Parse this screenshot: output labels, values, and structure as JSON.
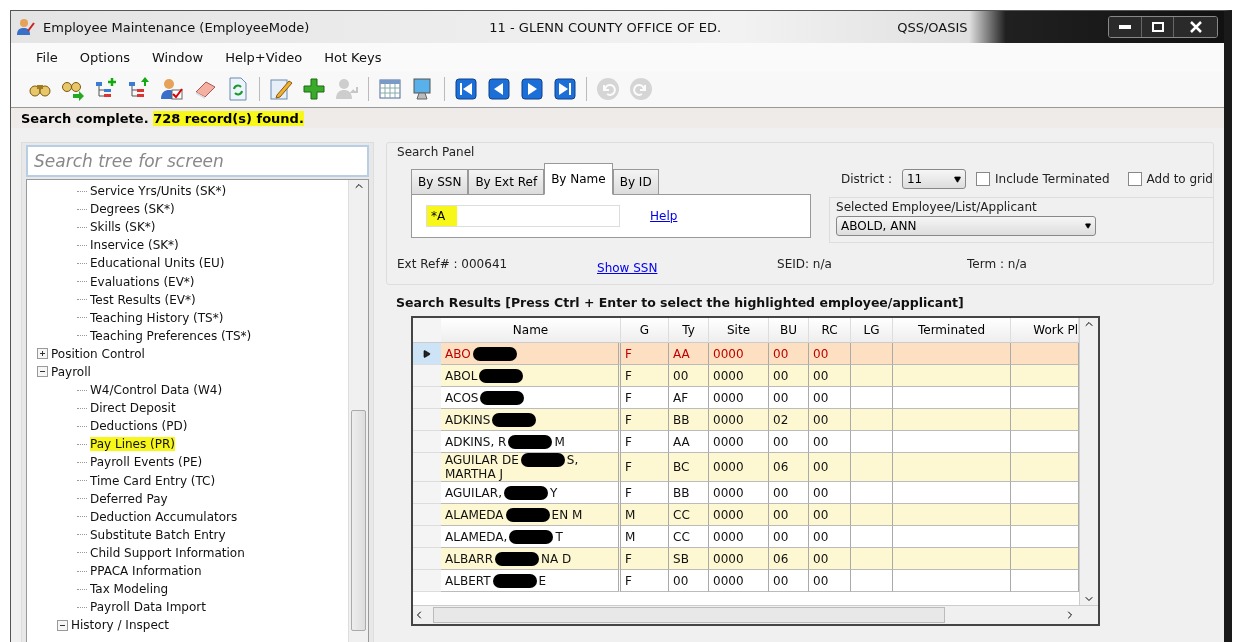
{
  "window": {
    "title": "Employee Maintenance (EmployeeMode)",
    "district_title": "11 - GLENN COUNTY OFFICE OF ED.",
    "product": "QSS/OASIS"
  },
  "menu": [
    "File",
    "Options",
    "Window",
    "Help+Video",
    "Hot Keys"
  ],
  "toolbar": [
    {
      "kind": "find",
      "disabled": false
    },
    {
      "kind": "find-next",
      "disabled": false
    },
    {
      "kind": "tree-add",
      "disabled": false
    },
    {
      "kind": "tree-up",
      "disabled": false
    },
    {
      "kind": "user-check",
      "disabled": false
    },
    {
      "kind": "eraser",
      "disabled": false
    },
    {
      "kind": "refresh",
      "disabled": false
    },
    {
      "kind": "separator"
    },
    {
      "kind": "edit",
      "disabled": false
    },
    {
      "kind": "add",
      "disabled": false
    },
    {
      "kind": "user-return",
      "disabled": true
    },
    {
      "kind": "separator"
    },
    {
      "kind": "grid",
      "disabled": false
    },
    {
      "kind": "monitor",
      "disabled": false
    },
    {
      "kind": "separator"
    },
    {
      "kind": "first",
      "disabled": false
    },
    {
      "kind": "prev",
      "disabled": false
    },
    {
      "kind": "next",
      "disabled": false
    },
    {
      "kind": "last",
      "disabled": false
    },
    {
      "kind": "separator"
    },
    {
      "kind": "undo",
      "disabled": true
    },
    {
      "kind": "redo",
      "disabled": true
    }
  ],
  "status": {
    "prefix": "Search complete.",
    "found": "728 record(s) found."
  },
  "tree": {
    "search_placeholder": "Search tree for screen",
    "partial_children": [
      {
        "label": "Service Yrs/Units (SK*)",
        "highlighted": false
      },
      {
        "label": "Degrees (SK*)",
        "highlighted": false
      },
      {
        "label": "Skills (SK*)",
        "highlighted": false
      },
      {
        "label": "Inservice (SK*)",
        "highlighted": false
      },
      {
        "label": "Educational Units (EU)",
        "highlighted": false
      },
      {
        "label": "Evaluations (EV*)",
        "highlighted": false
      },
      {
        "label": "Test Results (EV*)",
        "highlighted": false
      },
      {
        "label": "Teaching History (TS*)",
        "highlighted": false
      },
      {
        "label": "Teaching Preferences (TS*)",
        "highlighted": false
      }
    ],
    "nodes": [
      {
        "label": "Position Control",
        "expanded": false,
        "highlighted": false
      },
      {
        "label": "Payroll",
        "expanded": true,
        "highlighted": false,
        "children": [
          {
            "label": "W4/Control Data (W4)",
            "highlighted": false
          },
          {
            "label": "Direct Deposit",
            "highlighted": false
          },
          {
            "label": "Deductions (PD)",
            "highlighted": false
          },
          {
            "label": "Pay Lines (PR)",
            "highlighted": true
          },
          {
            "label": "Payroll Events (PE)",
            "highlighted": false
          },
          {
            "label": "Time Card Entry (TC)",
            "highlighted": false
          },
          {
            "label": "Deferred Pay",
            "highlighted": false
          },
          {
            "label": "Deduction Accumulators",
            "highlighted": false
          },
          {
            "label": "Substitute Batch Entry",
            "highlighted": false
          },
          {
            "label": "Child Support Information",
            "highlighted": false
          },
          {
            "label": "PPACA Information",
            "highlighted": false
          },
          {
            "label": "Tax Modeling",
            "highlighted": false
          },
          {
            "label": "Payroll Data Import",
            "highlighted": false
          },
          {
            "label": "History / Inspect",
            "highlighted": false,
            "expanded": true
          }
        ]
      }
    ]
  },
  "search_panel": {
    "title": "Search Panel",
    "tabs": [
      {
        "label": "By SSN",
        "selected": false
      },
      {
        "label": "By Ext Ref",
        "selected": false
      },
      {
        "label": "By Name",
        "selected": true
      },
      {
        "label": "By ID",
        "selected": false
      }
    ],
    "name_value": "*A",
    "help_link": "Help",
    "district_label": "District :",
    "district_value": "11",
    "include_terminated": {
      "label": "Include Terminated",
      "checked": false
    },
    "add_to_grid": {
      "label": "Add to grid",
      "checked": false
    },
    "selected_group_title": "Selected Employee/List/Applicant",
    "selected_value": "ABOLD, ANN",
    "ext_ref": "Ext Ref# : 000641",
    "show_ssn": "Show SSN",
    "seid": "SEID: n/a",
    "term": "Term : n/a"
  },
  "results": {
    "title": "Search Results [Press Ctrl + Enter to select the highlighted employee/applicant]",
    "columns": [
      "Name",
      "G",
      "Ty",
      "Site",
      "BU",
      "RC",
      "LG",
      "Terminated",
      "Work Pl"
    ],
    "rows": [
      {
        "selected": true,
        "name_tail": "",
        "name_line2": "",
        "cells": [
          "ABO",
          "F",
          "AA",
          "0000",
          "00",
          "00",
          "",
          "",
          ""
        ]
      },
      {
        "selected": false,
        "name_tail": "",
        "name_line2": "",
        "cells": [
          "ABOL",
          "F",
          "00",
          "0000",
          "00",
          "00",
          "",
          "",
          ""
        ]
      },
      {
        "selected": false,
        "name_tail": "",
        "name_line2": "",
        "cells": [
          "ACOS",
          "F",
          "AF",
          "0000",
          "00",
          "00",
          "",
          "",
          ""
        ]
      },
      {
        "selected": false,
        "name_tail": "",
        "name_line2": "",
        "cells": [
          "ADKINS",
          "F",
          "BB",
          "0000",
          "02",
          "00",
          "",
          "",
          ""
        ]
      },
      {
        "selected": false,
        "name_tail": "M",
        "name_line2": "",
        "cells": [
          "ADKINS, R",
          "F",
          "AA",
          "0000",
          "00",
          "00",
          "",
          "",
          ""
        ]
      },
      {
        "selected": false,
        "name_tail": "S,",
        "name_line2": "MARTHA J",
        "cells": [
          "AGUILAR DE",
          "F",
          "BC",
          "0000",
          "06",
          "00",
          "",
          "",
          ""
        ]
      },
      {
        "selected": false,
        "name_tail": "Y",
        "name_line2": "",
        "cells": [
          "AGUILAR,",
          "F",
          "BB",
          "0000",
          "00",
          "00",
          "",
          "",
          ""
        ]
      },
      {
        "selected": false,
        "name_tail": "EN M",
        "name_line2": "",
        "cells": [
          "ALAMEDA",
          "M",
          "CC",
          "0000",
          "00",
          "00",
          "",
          "",
          ""
        ]
      },
      {
        "selected": false,
        "name_tail": "T",
        "name_line2": "",
        "cells": [
          "ALAMEDA,",
          "M",
          "CC",
          "0000",
          "00",
          "00",
          "",
          "",
          ""
        ]
      },
      {
        "selected": false,
        "name_tail": "NA D",
        "name_line2": "",
        "cells": [
          "ALBARR",
          "F",
          "SB",
          "0000",
          "06",
          "00",
          "",
          "",
          ""
        ]
      },
      {
        "selected": false,
        "name_tail": "E",
        "name_line2": "",
        "cells": [
          "ALBERT",
          "F",
          "00",
          "0000",
          "00",
          "00",
          "",
          "",
          ""
        ]
      }
    ]
  }
}
